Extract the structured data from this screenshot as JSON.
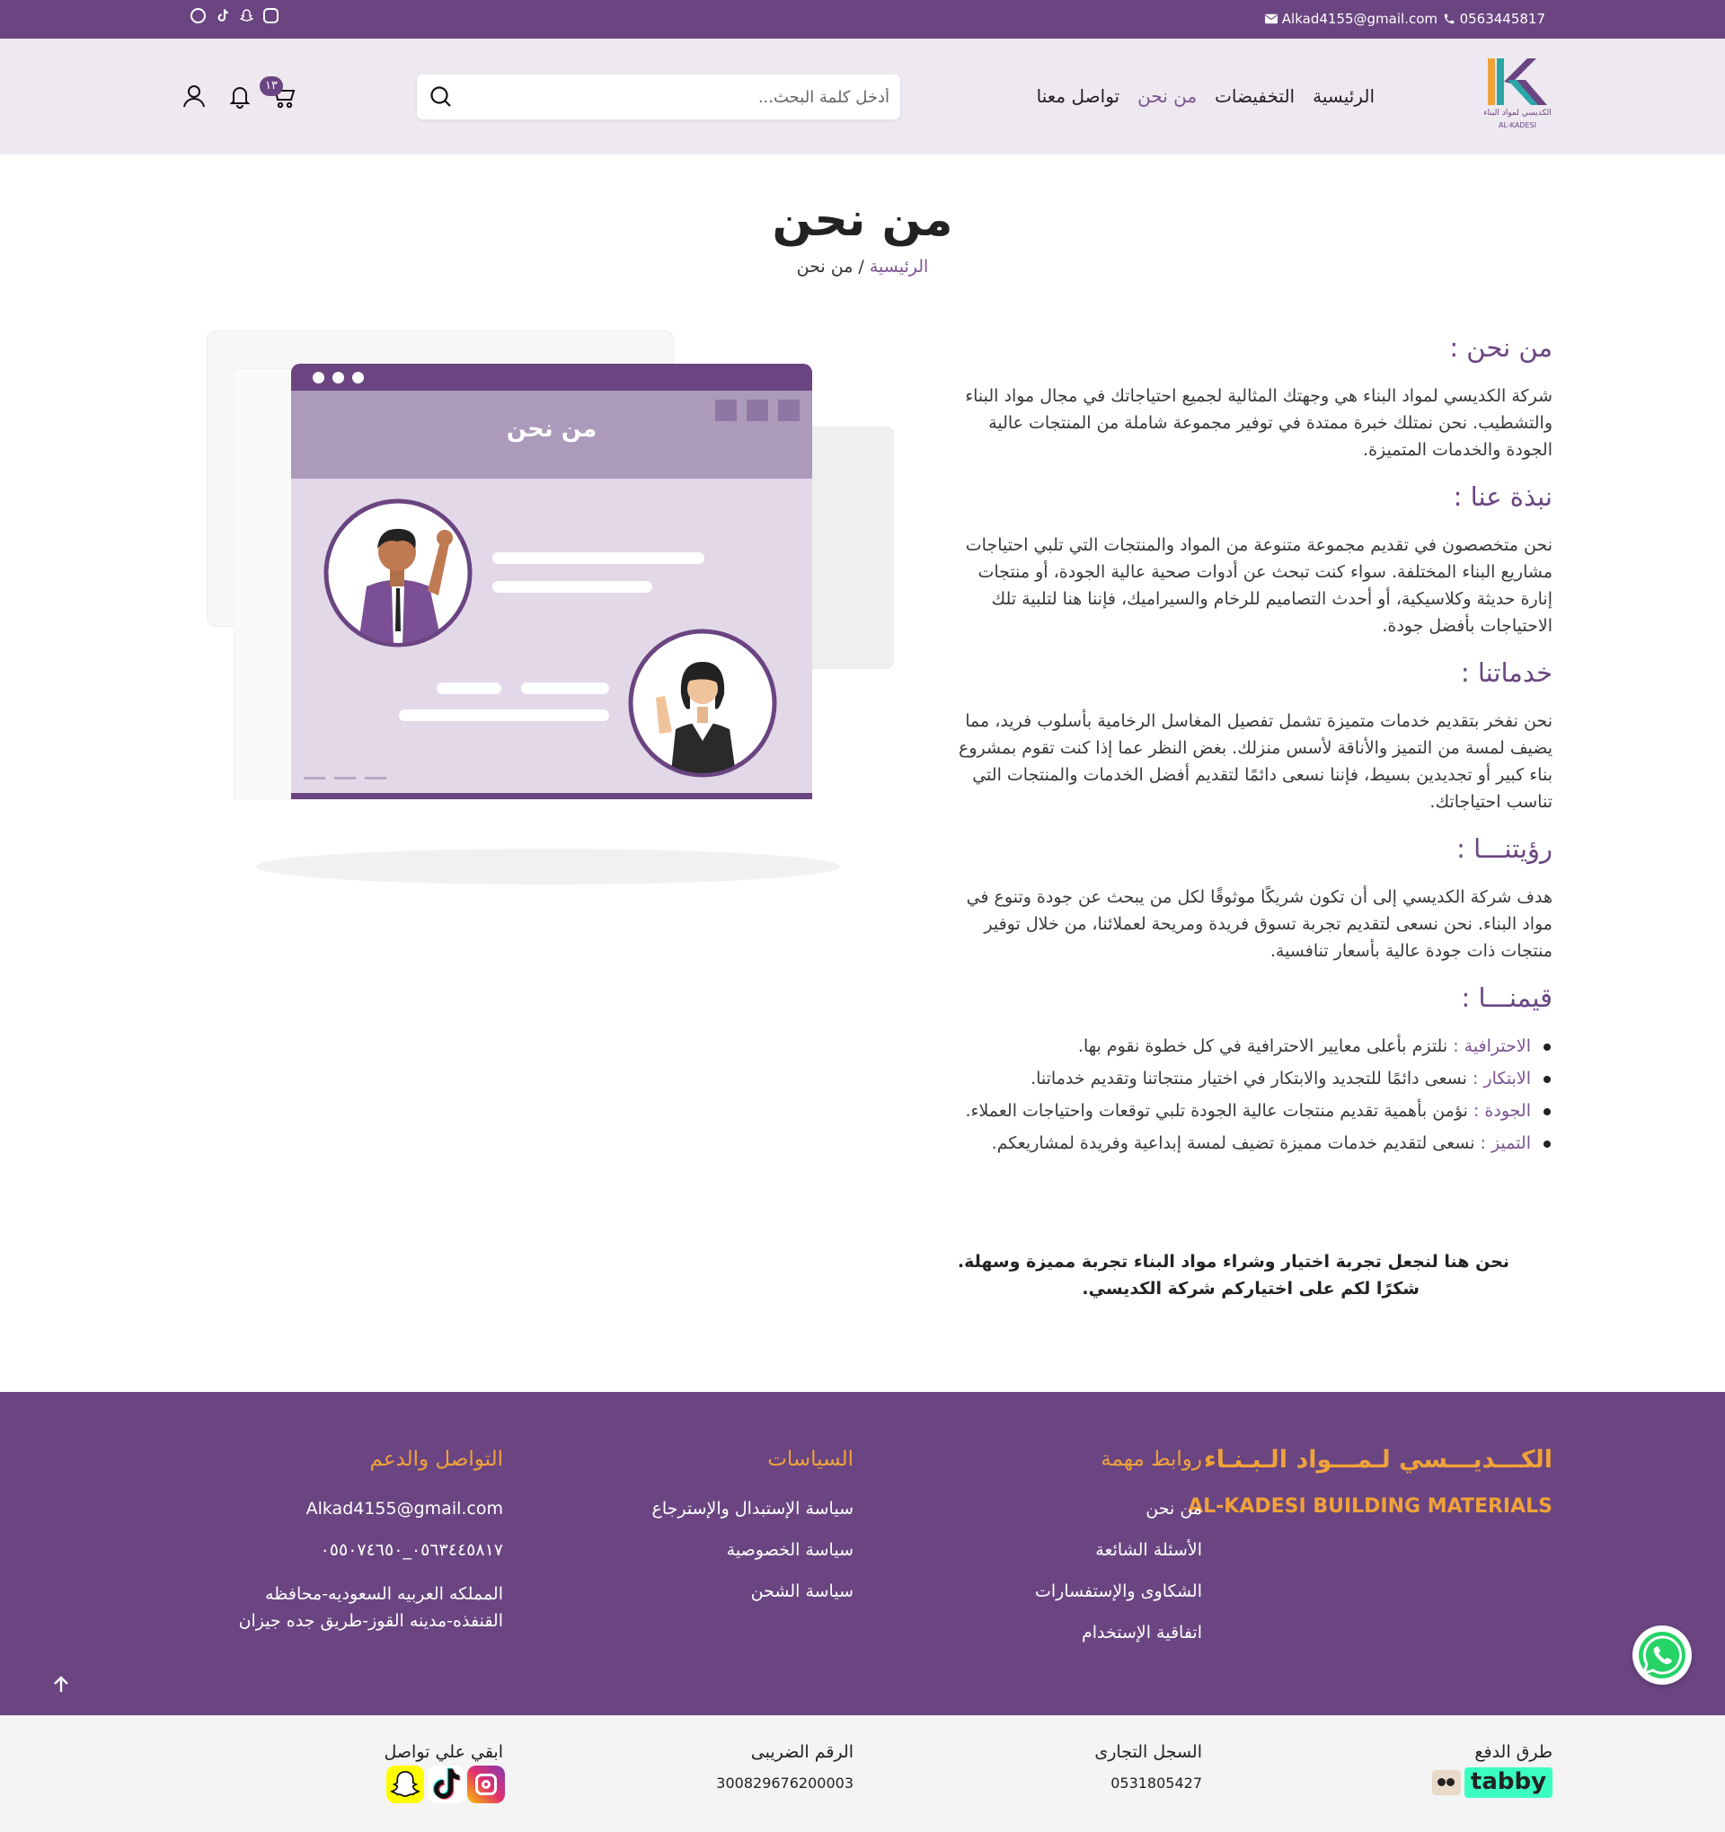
{
  "topbar": {
    "phone": "0563445817",
    "email": "Alkad4155@gmail.com",
    "social_icons": [
      "whatsapp-icon",
      "tiktok-icon",
      "snapchat-icon",
      "instagram-icon"
    ]
  },
  "header": {
    "logo_text_ar": "الكديسي لمواد البناء",
    "logo_text_en": "AL-KADESI",
    "nav": [
      "الرئيسية",
      "التخفيضات",
      "من نحن",
      "تواصل معنا"
    ],
    "active_nav": "من نحن",
    "search_placeholder": "أدخل كلمة البحث...",
    "cart_count": "١٣",
    "icons": [
      "cart-icon",
      "bell-icon",
      "user-icon",
      "search-icon"
    ]
  },
  "hero": {
    "title": "من نحن",
    "breadcrumb_home": "الرئيسية",
    "breadcrumb_sep": " / ",
    "breadcrumb_current": "من نحن"
  },
  "illustration": {
    "window_title": "من نحن"
  },
  "content": {
    "about_heading": "من نحن :",
    "about_text": "شركة الكديسي لمواد البناء هي وجهتك المثالية لجميع احتياجاتك في مجال مواد البناء والتشطيب. نحن نمتلك خبرة ممتدة في توفير مجموعة شاملة من المنتجات عالية الجودة والخدمات المتميزة.",
    "brief_heading": "نبذة عنا :",
    "brief_text": "نحن متخصصون في تقديم مجموعة متنوعة من المواد والمنتجات التي تلبي احتياجات مشاريع البناء المختلفة. سواء كنت تبحث عن أدوات صحية عالية الجودة، أو منتجات إنارة حديثة وكلاسيكية، أو أحدث التصاميم للرخام والسيراميك، فإننا هنا لتلبية تلك الاحتياجات بأفضل جودة.",
    "services_heading": "خدماتنا :",
    "services_text": "نحن نفخر بتقديم خدمات متميزة تشمل تفصيل المغاسل الرخامية بأسلوب فريد، مما يضيف لمسة من التميز والأناقة لأسس منزلك. بغض النظر عما إذا كنت تقوم بمشروع بناء كبير أو تجديدين بسيط، فإننا نسعى دائمًا لتقديم أفضل الخدمات والمنتجات التي تناسب احتياجاتك.",
    "vision_heading": "رؤيتنـــا :",
    "vision_text": "هدف شركة الكديسي إلى أن تكون شريكًا موثوقًا لكل من يبحث عن جودة وتنوع في مواد البناء. نحن نسعى لتقديم تجربة تسوق فريدة ومريحة لعملائنا، من خلال توفير منتجات ذات جودة عالية بأسعار تنافسية.",
    "values_heading": "قيمنـــا :",
    "values": [
      {
        "term": "الاحترافية :",
        "text": " نلتزم بأعلى معايير الاحترافية في كل خطوة نقوم بها."
      },
      {
        "term": "الابتكار :",
        "text": " نسعى دائمًا للتجديد والابتكار في اختيار منتجاتنا وتقديم خدماتنا."
      },
      {
        "term": "الجودة :",
        "text": " نؤمن بأهمية تقديم منتجات عالية الجودة تلبي توقعات واحتياجات العملاء."
      },
      {
        "term": "التميز :",
        "text": " نسعى لتقديم خدمات مميزة تضيف لمسة إبداعية وفريدة لمشاريعكم."
      }
    ],
    "closing_line1": "نحن هنا لنجعل تجربة اختيار وشراء مواد البناء تجربة مميزة وسهلة.",
    "closing_line2": "شكرًا لكم على اختياركم شركة الكديسي."
  },
  "footer": {
    "brand_ar": "الكـــديـــسي لـمـــواد الـبـنـاء",
    "brand_en": "AL-KADESI BUILDING MATERIALS",
    "links_heading": "روابط مهمة",
    "links": [
      "من نحن",
      "الأسئلة الشائعة",
      "الشكاوى والإستفسارات",
      "اتفاقية الإستخدام"
    ],
    "policies_heading": "السياسات",
    "policies": [
      "سياسة الإستبدال والإسترجاع",
      "سياسة الخصوصية",
      "سياسة الشحن"
    ],
    "support_heading": "التواصل والدعم",
    "support_email": "Alkad4155@gmail.com",
    "support_phones": "٠٥٦٣٤٤٥٨١٧_٠٥٥٠٧٤٦٥٠",
    "support_address": "المملكه العربيه السعوديه-محافظه القنفذه-مدينه القوز-طريق جده جيزان"
  },
  "bottom": {
    "payment_label": "طرق الدفع",
    "payment_brand": "tabby",
    "cr_label": "السجل التجارى",
    "cr_value": "0531805427",
    "tax_label": "الرقم الضريبى",
    "tax_value": "300829676200003",
    "contact_label": "ابقي علي تواصل"
  },
  "colors": {
    "primary": "#6a4581",
    "accent_orange": "#f0a23a",
    "header_bg": "#eee8f0",
    "link_purple": "#7c5592"
  }
}
